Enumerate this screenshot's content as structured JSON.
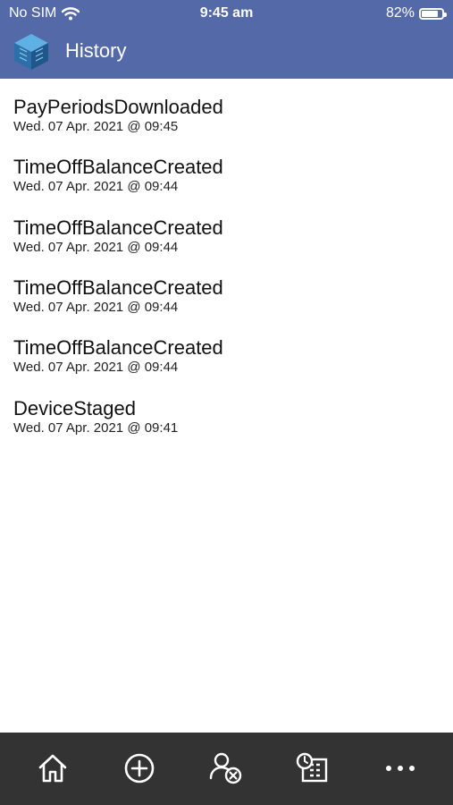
{
  "status_bar": {
    "carrier": "No SIM",
    "time": "9:45 am",
    "battery_text": "82%",
    "battery_level": 0.82,
    "wifi_icon": "wifi-icon"
  },
  "header": {
    "title": "History",
    "logo_icon": "app-cube-logo",
    "background_color": "#5469a8"
  },
  "history": [
    {
      "event": "PayPeriodsDownloaded",
      "timestamp": "Wed. 07 Apr. 2021 @ 09:45"
    },
    {
      "event": "TimeOffBalanceCreated",
      "timestamp": "Wed. 07 Apr. 2021 @ 09:44"
    },
    {
      "event": "TimeOffBalanceCreated",
      "timestamp": "Wed. 07 Apr. 2021 @ 09:44"
    },
    {
      "event": "TimeOffBalanceCreated",
      "timestamp": "Wed. 07 Apr. 2021 @ 09:44"
    },
    {
      "event": "TimeOffBalanceCreated",
      "timestamp": "Wed. 07 Apr. 2021 @ 09:44"
    },
    {
      "event": "DeviceStaged",
      "timestamp": "Wed. 07 Apr. 2021 @ 09:41"
    }
  ],
  "tabbar": {
    "background_color": "#333333",
    "icons": [
      "home-icon",
      "add-circle-icon",
      "user-remove-icon",
      "timesheet-calendar-icon",
      "more-icon"
    ]
  }
}
